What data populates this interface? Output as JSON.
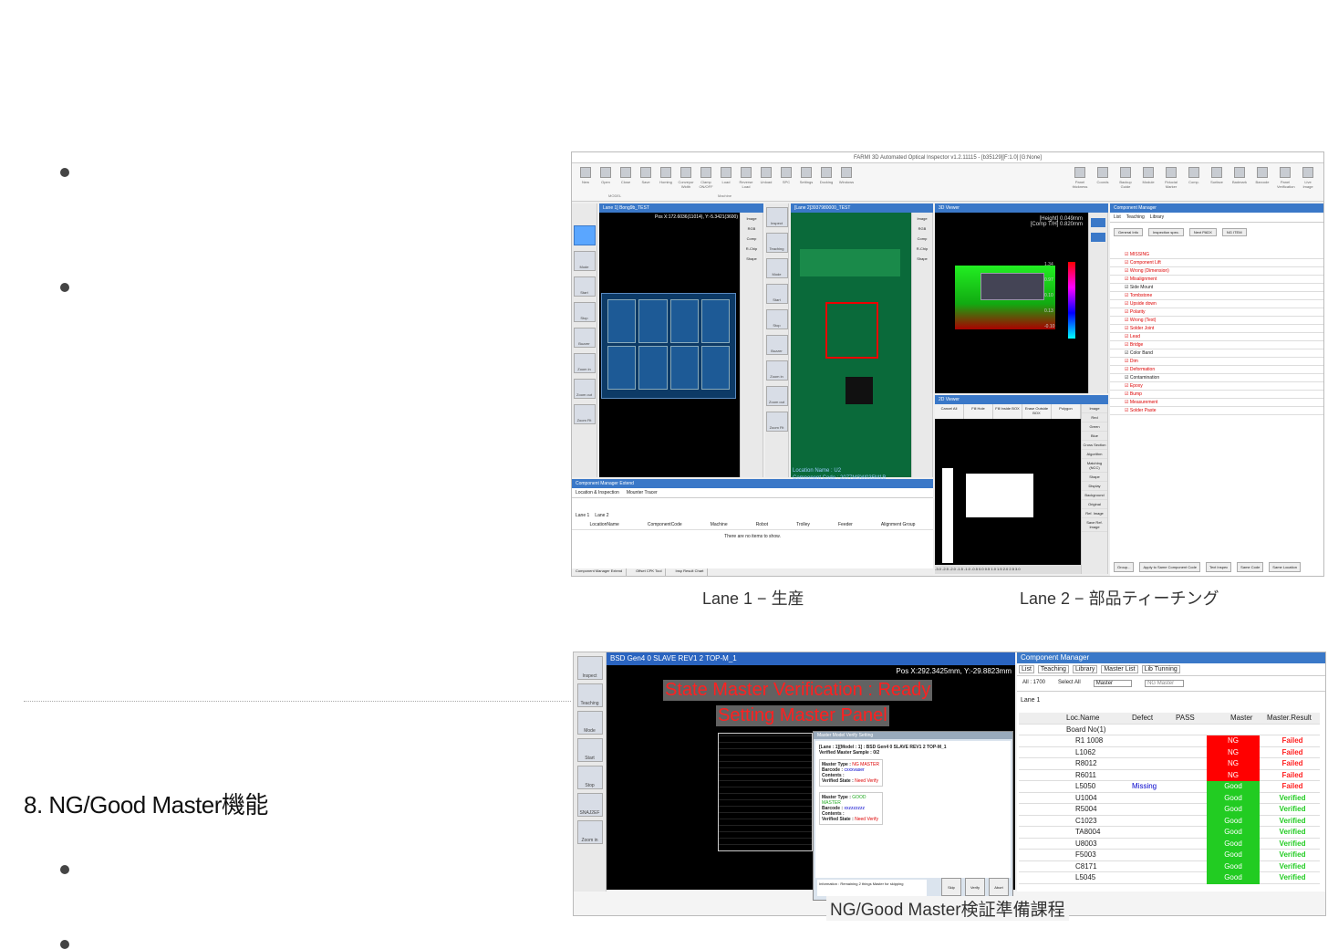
{
  "bullets_top": [
    "",
    ""
  ],
  "heading": "8. NG/Good Master機能",
  "bullets_bottom": [
    "",
    ""
  ],
  "shot1": {
    "window_title": "FARMI 3D Automated Optical Inspector v1.2.11115 - [b35129][F:1.0] [G:None]",
    "ribbon_left": [
      "New",
      "Open",
      "Close",
      "Save",
      "Homing",
      "Conveyor Width",
      "Clamp ON/OFF",
      "Load",
      "Reverse Load",
      "Unload",
      "SPC",
      "Settings",
      "Docking",
      "Windows"
    ],
    "ribbon_groups": [
      "MODEL",
      "Machine"
    ],
    "ribbon_right": [
      "Panel thickness",
      "Coords",
      "Backup Guide",
      "Module",
      "Fiducial Marker",
      "Comp.",
      "Surface",
      "Badmark",
      "Barcode",
      "Panel Verification",
      "Live Image"
    ],
    "lane1_header": "Lane 1] Bong9b_TEST",
    "lane1_pos": "Pos X:172.6036(11014), Y:-5.3421(3600)",
    "lane2_header": "[Lane 2]3937980000_TEST",
    "lane2_location": "Location Name : U2",
    "lane2_component": "Component Code : 2077MSW035M1B",
    "tools_left": [
      "Inspect",
      "Mode",
      "Start",
      "Stop",
      "Buzzer",
      "Zoom in",
      "Zoom out",
      "Zoom Fit"
    ],
    "tools_mid": [
      "Inspect",
      "Teaching",
      "Mode",
      "Start",
      "Stop",
      "Buzzer",
      "Zoom in",
      "Zoom out",
      "Zoom Fit"
    ],
    "image_menu": [
      "Image",
      "RGB",
      "Comp",
      "R-Chip",
      "Shape"
    ],
    "viewer3d_title": "3D Viewer",
    "viewer3d_height": "[Height] 0.049mm",
    "viewer3d_comp": "[Comp T/H] 0.820mm",
    "scale_labels": [
      "1.34",
      "0.97",
      "0.10",
      "0.13",
      "-0.10"
    ],
    "viewer2d_title": "2D Viewer",
    "viewer2d_buttons": [
      "Cancel All",
      "Fill Hole",
      "Fill Inside BOX",
      "Erase Outside BOX",
      "Polygon"
    ],
    "image_side": [
      "Image",
      "Red",
      "Green",
      "Blue",
      "Cross Section",
      "Algorithm",
      "Matching (NCC)",
      "Shape",
      "Display",
      "Background",
      "Original",
      "Ref. Image",
      "Save Ref. Image"
    ],
    "cm_title": "Component Manager",
    "cm_tabs": [
      "List",
      "Teaching",
      "Library"
    ],
    "cm_buttons": [
      "General Info",
      "Inspection spec.",
      "Next PADX",
      "NG ITEM"
    ],
    "cm_items": [
      {
        "t": "MISSING",
        "c": "red"
      },
      {
        "t": "Component Lift",
        "c": "red"
      },
      {
        "t": "Wrong (Dimension)",
        "c": "red"
      },
      {
        "t": "Misalignment",
        "c": "red"
      },
      {
        "t": "Side Mount",
        "c": ""
      },
      {
        "t": "Tombstone",
        "c": "red"
      },
      {
        "t": "Upside down",
        "c": "red"
      },
      {
        "t": "Polarity",
        "c": "red"
      },
      {
        "t": "Wrong (Text)",
        "c": "red"
      },
      {
        "t": "Solder Joint",
        "c": "red"
      },
      {
        "t": "Lead",
        "c": "red"
      },
      {
        "t": "Bridge",
        "c": "red"
      },
      {
        "t": "Color Band",
        "c": ""
      },
      {
        "t": "Dim",
        "c": "red"
      },
      {
        "t": "Deformation",
        "c": "red"
      },
      {
        "t": "Contamination",
        "c": ""
      },
      {
        "t": "Epoxy",
        "c": "red"
      },
      {
        "t": "Bump",
        "c": "red"
      },
      {
        "t": "Measurement",
        "c": "red"
      },
      {
        "t": "Solder Paste",
        "c": "red"
      }
    ],
    "cm_bottom": [
      "Group...",
      "Apply to Same Component Code",
      "Text Inspec",
      "Same Code",
      "Same Location"
    ],
    "ext_title": "Component Manager Extend",
    "ext_tabs": [
      "Location & Inspection",
      "Mounter Tracer"
    ],
    "ext_lanes": [
      "Lane 1",
      "Lane 2"
    ],
    "ext_cols": [
      "LocationName",
      "ComponentCode",
      "Machine",
      "Robot",
      "Trolley",
      "Feeder",
      "Alignment Group"
    ],
    "ext_empty": "There are no items to show.",
    "ext_bottom_tabs": [
      "Component Manager Extend",
      "Offset CPK Tool",
      "Insp Result Chart"
    ],
    "axis_ticks": "-3.0 -2.5 -2.0 -1.5 -1.0 -0.5 0.0 0.5 1.0 1.5 2.0 2.5 3.0"
  },
  "caption1_left": "Lane 1 − 生産",
  "caption1_right": "Lane 2 − 部品ティーチング",
  "shot2": {
    "header": "BSD Gen4 0 SLAVE REV1 2 TOP-M_1",
    "pos": "Pos X:292.3425mm, Y:-29.8823mm",
    "state1": "State Master Verification : Ready",
    "state2": "Setting Master Panel",
    "tools": [
      "Inspect",
      "Teaching",
      "Mode",
      "Start",
      "Stop",
      "SNAJ2EF",
      "Zoom in"
    ],
    "dialog_title": "Master Model Verify Setting",
    "dialog_line1": "[Lane : 1][Model : 1] : BSD Gen4 0 SLAVE REV1 2 TOP-M_1",
    "dialog_line2": "Verified Master Sample : 0/2",
    "m1": {
      "type": "NG MASTER",
      "barcode": "cxxxvaser",
      "contents": "",
      "state": "Need Verify"
    },
    "m2": {
      "type": "GOOD MASTER",
      "barcode": "xxzzzzzzz",
      "contents": "",
      "state": "Need Verify"
    },
    "labels": {
      "type": "Master Type :",
      "barcode": "Barcode :",
      "contents": "Contents :",
      "state": "Verified State :"
    },
    "dialog_msg": "Information : Remaining 2 things Master for skipping",
    "dialog_buttons": [
      "Skip",
      "Verify",
      "Abort"
    ],
    "cm_title": "Component Manager",
    "tabs": [
      "List",
      "Teaching",
      "Library",
      "Master List",
      "Lib Tunning"
    ],
    "filter_all": "All : 1700",
    "filter_select": "Select All",
    "filter_master": "Master",
    "filter_ngmaster": "NG Master",
    "lane": "Lane 1",
    "cols": [
      "Loc.Name",
      "Defect",
      "PASS",
      "Master",
      "Master.Result"
    ],
    "board": "Board No(1)",
    "rows": [
      {
        "n": "R1 1008",
        "d": "",
        "m": "NG",
        "r": "Failed"
      },
      {
        "n": "L1062",
        "d": "",
        "m": "NG",
        "r": "Failed"
      },
      {
        "n": "R8012",
        "d": "",
        "m": "NG",
        "r": "Failed"
      },
      {
        "n": "R6011",
        "d": "",
        "m": "NG",
        "r": "Failed"
      },
      {
        "n": "L5050",
        "d": "Missing",
        "m": "Good",
        "r": "Failed"
      },
      {
        "n": "U1004",
        "d": "",
        "m": "Good",
        "r": "Verified"
      },
      {
        "n": "R5004",
        "d": "",
        "m": "Good",
        "r": "Verified"
      },
      {
        "n": "C1023",
        "d": "",
        "m": "Good",
        "r": "Verified"
      },
      {
        "n": "TA8004",
        "d": "",
        "m": "Good",
        "r": "Verified"
      },
      {
        "n": "U8003",
        "d": "",
        "m": "Good",
        "r": "Verified"
      },
      {
        "n": "F5003",
        "d": "",
        "m": "Good",
        "r": "Verified"
      },
      {
        "n": "C8171",
        "d": "",
        "m": "Good",
        "r": "Verified"
      },
      {
        "n": "L5045",
        "d": "",
        "m": "Good",
        "r": "Verified"
      }
    ]
  },
  "caption2": "NG/Good Master検証準備課程",
  "colors": {
    "ng": "#ff0000",
    "good": "#22cc22",
    "failed": "#ff2020",
    "verified": "#22cc22",
    "accent": "#3a78c8"
  }
}
